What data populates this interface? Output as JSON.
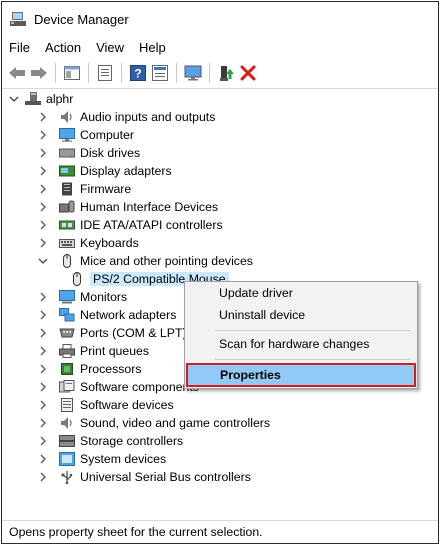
{
  "title": "Device Manager",
  "menu": [
    "File",
    "Action",
    "View",
    "Help"
  ],
  "toolbar": [
    "back-icon",
    "forward-icon",
    "properties-pane-icon",
    "device-list-icon",
    "help-icon",
    "device-properties-icon",
    "monitor-icon",
    "enable-device-icon",
    "uninstall-icon"
  ],
  "tree": {
    "root": "alphr",
    "categories": [
      {
        "label": "Audio inputs and outputs",
        "icon": "speaker-icon"
      },
      {
        "label": "Computer",
        "icon": "computer-icon"
      },
      {
        "label": "Disk drives",
        "icon": "disk-icon"
      },
      {
        "label": "Display adapters",
        "icon": "display-adapter-icon"
      },
      {
        "label": "Firmware",
        "icon": "firmware-icon"
      },
      {
        "label": "Human Interface Devices",
        "icon": "hid-icon"
      },
      {
        "label": "IDE ATA/ATAPI controllers",
        "icon": "ide-controller-icon"
      },
      {
        "label": "Keyboards",
        "icon": "keyboard-icon"
      },
      {
        "label": "Mice and other pointing devices",
        "icon": "mouse-icon",
        "expanded": true,
        "child": "PS/2 Compatible Mouse"
      },
      {
        "label": "Monitors",
        "icon": "monitor-icon"
      },
      {
        "label": "Network adapters",
        "icon": "network-icon"
      },
      {
        "label": "Ports (COM & LPT)",
        "icon": "port-icon"
      },
      {
        "label": "Print queues",
        "icon": "printer-icon"
      },
      {
        "label": "Processors",
        "icon": "processor-icon"
      },
      {
        "label": "Software components",
        "icon": "software-component-icon"
      },
      {
        "label": "Software devices",
        "icon": "software-device-icon"
      },
      {
        "label": "Sound, video and game controllers",
        "icon": "sound-icon"
      },
      {
        "label": "Storage controllers",
        "icon": "storage-icon"
      },
      {
        "label": "System devices",
        "icon": "system-icon"
      },
      {
        "label": "Universal Serial Bus controllers",
        "icon": "usb-icon"
      }
    ]
  },
  "context_menu": {
    "items": [
      "Update driver",
      "Uninstall device",
      "Scan for hardware changes",
      "Properties"
    ],
    "highlighted": "Properties"
  },
  "status": "Opens property sheet for the current selection.",
  "colors": {
    "selection": "#cce8ff",
    "menu_highlight": "#91c9f7",
    "outline_red": "#d81a1a"
  }
}
